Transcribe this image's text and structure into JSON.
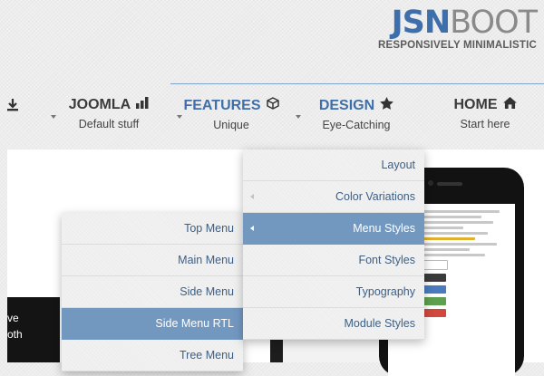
{
  "logo": {
    "jsn": "JSN",
    "boot": "BOOT",
    "tagline": "RESPONSIVELY MINIMALISTIC"
  },
  "nav": {
    "items": [
      {
        "title": "JOOMLA",
        "subtitle": "Default stuff"
      },
      {
        "title": "FEATURES",
        "subtitle": "Unique"
      },
      {
        "title": "DESIGN",
        "subtitle": "Eye-Catching"
      },
      {
        "title": "HOME",
        "subtitle": "Start here"
      }
    ]
  },
  "menu_main": {
    "items": [
      {
        "label": "Layout"
      },
      {
        "label": "Color Variations"
      },
      {
        "label": "Menu Styles"
      },
      {
        "label": "Font Styles"
      },
      {
        "label": "Typography"
      },
      {
        "label": "Module Styles"
      }
    ],
    "active_index": 2
  },
  "menu_sub": {
    "items": [
      {
        "label": "Top Menu"
      },
      {
        "label": "Main Menu"
      },
      {
        "label": "Side Menu"
      },
      {
        "label": "Side Menu RTL"
      },
      {
        "label": "Tree Menu"
      }
    ],
    "active_index": 3
  },
  "dark_panel": {
    "line1": "ve",
    "line2": "oth"
  },
  "colors": {
    "accent": "#3f6faa",
    "menu_active": "#7398c0",
    "menu_text": "#3d5f85"
  },
  "icons": [
    "download-icon",
    "bar-chart-icon",
    "cube-icon",
    "star-icon",
    "home-icon"
  ]
}
